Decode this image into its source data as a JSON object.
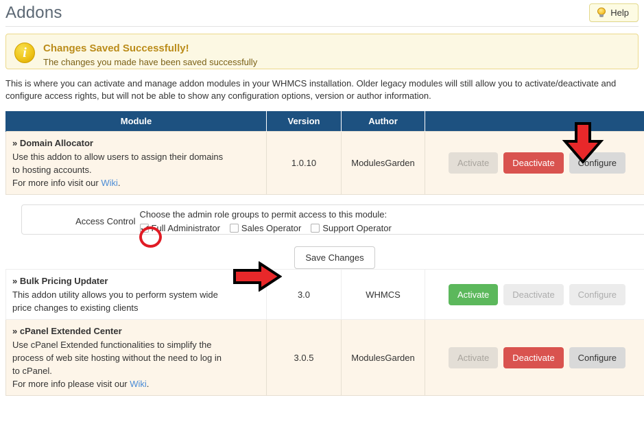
{
  "header": {
    "title": "Addons",
    "help_label": "Help",
    "help_icon": "lightbulb-icon"
  },
  "alert": {
    "icon": "info-icon",
    "title": "Changes Saved Successfully!",
    "body": "The changes you made have been saved successfully"
  },
  "intro": "This is where you can activate and manage addon modules in your WHMCS installation. Older legacy modules will still allow you to activate/deactivate and configure access rights, but will not be able to show any configuration options, version or author information.",
  "table": {
    "columns": [
      "Module",
      "Version",
      "Author",
      ""
    ],
    "rows": [
      {
        "name": "» Domain Allocator",
        "desc_line1": "Use this addon to allow users to assign their domains",
        "desc_line2": "to hosting accounts.",
        "desc_line3_pre": "For more info visit our ",
        "wiki_label": "Wiki",
        "desc_line3_post": ".",
        "version": "1.0.10",
        "author": "ModulesGarden",
        "activate_label": "Activate",
        "deactivate_label": "Deactivate",
        "configure_label": "Configure"
      },
      {
        "name": "» Bulk Pricing Updater",
        "desc_line1": "This addon utility allows you to perform system wide",
        "desc_line2": "price changes to existing clients",
        "version": "3.0",
        "author": "WHMCS",
        "activate_label": "Activate",
        "deactivate_label": "Deactivate",
        "configure_label": "Configure"
      },
      {
        "name": "» cPanel Extended Center",
        "desc_line1": "Use cPanel Extended functionalities to simplify the",
        "desc_line2": "process of web site hosting without the need to log in",
        "desc_line3": "to cPanel.",
        "desc_line4_pre": "For more info please visit our ",
        "wiki_label": "Wiki",
        "desc_line4_post": ".",
        "version": "3.0.5",
        "author": "ModulesGarden",
        "activate_label": "Activate",
        "deactivate_label": "Deactivate",
        "configure_label": "Configure"
      }
    ]
  },
  "access_control": {
    "label": "Access Control",
    "instruction": "Choose the admin role groups to permit access to this module:",
    "roles": [
      {
        "label": "Full Administrator",
        "checked": true
      },
      {
        "label": "Sales Operator",
        "checked": false
      },
      {
        "label": "Support Operator",
        "checked": false
      }
    ]
  },
  "save": {
    "label": "Save Changes"
  },
  "annotations": {
    "arrow_down_target": "configure-button",
    "arrow_right_target": "save-changes-button",
    "circle_target": "full-administrator-checkbox",
    "color": "#e8282a"
  }
}
